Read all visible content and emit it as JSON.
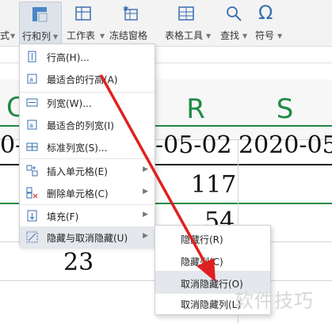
{
  "toolbar": {
    "cut_label": "式",
    "row_col_label": "行和列",
    "worksheet_label": "工作表",
    "freeze_label": "冻结窗格",
    "table_tools_label": "表格工具",
    "find_label": "查找",
    "symbol_label": "符号"
  },
  "sheet": {
    "col_left": "C",
    "col_r": "R",
    "col_s": "S",
    "date_left": "0-",
    "date_r": "-05-02",
    "date_s": "2020-05",
    "val_117": "117",
    "val_54": "54",
    "val_23": "23"
  },
  "menu": {
    "items": [
      {
        "label": "行高(H)...",
        "icon": "row-height-icon"
      },
      {
        "label": "最适合的行高(A)",
        "icon": "fit-row-height-icon"
      },
      {
        "label": "列宽(W)...",
        "icon": "col-width-icon"
      },
      {
        "label": "最适合的列宽(I)",
        "icon": "fit-col-width-icon"
      },
      {
        "label": "标准列宽(S)...",
        "icon": "standard-col-width-icon"
      },
      {
        "label": "插入单元格(E)",
        "icon": "insert-cells-icon"
      },
      {
        "label": "删除单元格(C)",
        "icon": "delete-cells-icon"
      },
      {
        "label": "填充(F)",
        "icon": "fill-icon"
      },
      {
        "label": "隐藏与取消隐藏(U)",
        "icon": "hide-unhide-icon"
      }
    ]
  },
  "submenu": {
    "items": [
      {
        "label": "隐藏行(R)"
      },
      {
        "label": "隐藏列(C)"
      },
      {
        "label": "取消隐藏行(O)"
      },
      {
        "label": "取消隐藏列(L)"
      }
    ]
  },
  "watermark": "软件技巧",
  "colors": {
    "accent_green": "#1f8b46",
    "arrow_red": "#e02020"
  }
}
